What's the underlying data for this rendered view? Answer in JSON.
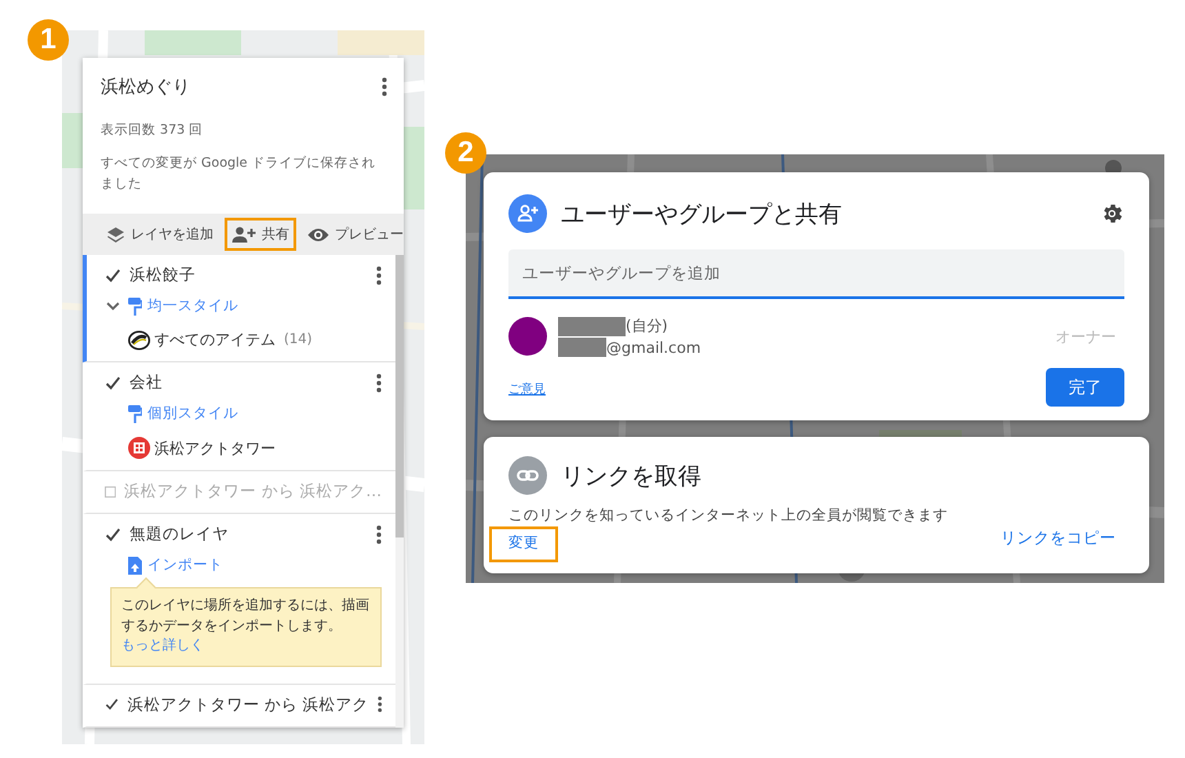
{
  "step_1": {
    "badge": "1",
    "title": "浜松めぐり",
    "views": "表示回数 373 回",
    "save_status": "すべての変更が Google ドライブに保存されました",
    "toolbar": [
      {
        "kind": "add-layer",
        "label": "レイヤを追加",
        "highlighted": false
      },
      {
        "kind": "share",
        "label": "共有",
        "highlighted": true
      },
      {
        "kind": "preview",
        "label": "プレビュー",
        "highlighted": false
      }
    ],
    "layers": [
      {
        "title": "浜松餃子",
        "checked": true,
        "selected": true,
        "expanded": true,
        "menu": true,
        "link": {
          "kind": "style",
          "label": "均一スタイル"
        },
        "items": [
          {
            "kind": "all",
            "label": "すべてのアイテム",
            "count": "(14)"
          }
        ]
      },
      {
        "title": "会社",
        "checked": true,
        "selected": false,
        "expanded": false,
        "menu": true,
        "link": {
          "kind": "style",
          "label": "個別スタイル"
        },
        "items": [
          {
            "kind": "place",
            "label": "浜松アクトタワー"
          }
        ]
      },
      {
        "title": "浜松アクトタワー から 浜松アク…",
        "checked": false,
        "selected": false,
        "expanded": false,
        "menu": false
      },
      {
        "title": "無題のレイヤ",
        "checked": true,
        "selected": false,
        "expanded": false,
        "menu": true,
        "link": {
          "kind": "import",
          "label": "インポート"
        },
        "tip": {
          "text": "このレイヤに場所を追加するには、描画するかデータをインポートします。",
          "link": "もっと詳しく"
        }
      },
      {
        "title": "浜松アクトタワー から 浜松アク",
        "checked": true,
        "selected": false,
        "expanded": false,
        "menu": true
      }
    ]
  },
  "step_2": {
    "badge": "2",
    "share": {
      "title": "ユーザーやグループと共有",
      "placeholder": "ユーザーやグループを追加",
      "owner": {
        "name_suffix": "(自分)",
        "email_suffix": "@gmail.com",
        "role": "オーナー"
      },
      "feedback": "ご意見",
      "done": "完了"
    },
    "link": {
      "title": "リンクを取得",
      "description": "このリンクを知っているインターネット上の全員が閲覧できます",
      "change": {
        "label": "変更",
        "highlighted": true
      },
      "copy": "リンクをコピー"
    }
  }
}
